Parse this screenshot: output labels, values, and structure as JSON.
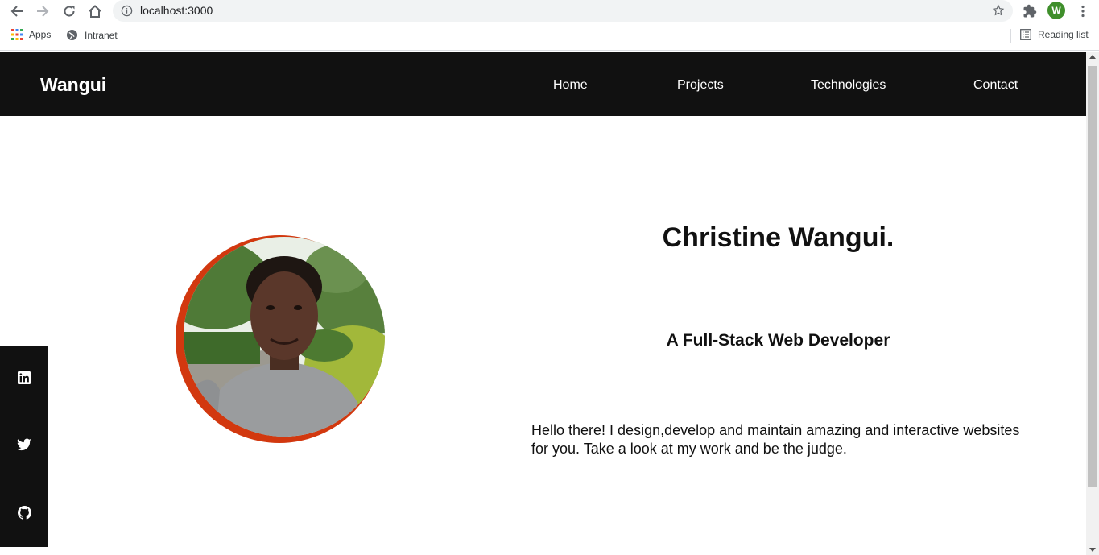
{
  "browser": {
    "url": "localhost:3000",
    "profile_initial": "W",
    "bookmarks": [
      {
        "label": "Apps",
        "icon": "apps-grid-icon"
      },
      {
        "label": "Intranet",
        "icon": "globe-icon"
      }
    ],
    "reading_list": "Reading list"
  },
  "navbar": {
    "brand": "Wangui",
    "links": [
      {
        "label": "Home"
      },
      {
        "label": "Projects"
      },
      {
        "label": "Technologies"
      },
      {
        "label": "Contact"
      }
    ]
  },
  "hero": {
    "name": "Christine Wangui.",
    "role": "A Full-Stack Web Developer",
    "bio": "Hello there! I design,develop and maintain amazing and interactive websites for you. Take a look at my work and be the judge."
  },
  "social": [
    {
      "icon": "linkedin-icon"
    },
    {
      "icon": "twitter-icon"
    },
    {
      "icon": "github-icon"
    }
  ],
  "colors": {
    "navbar_bg": "#111111",
    "accent_ring": "#d2380f",
    "text": "#111111"
  }
}
